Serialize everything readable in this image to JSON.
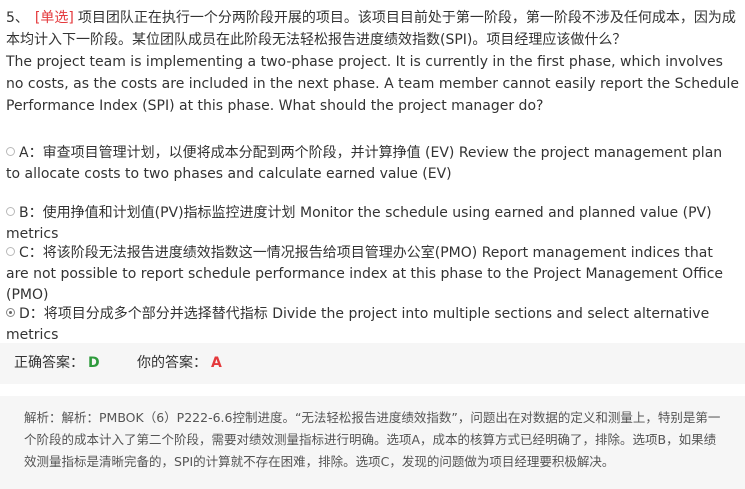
{
  "question": {
    "number": "5、",
    "type": "[单选]",
    "text_cn": "项目团队正在执行一个分两阶段开展的项目。该项目目前处于第一阶段，第一阶段不涉及任何成本，因为成本均计入下一阶段。某位团队成员在此阶段无法轻松报告进度绩效指数(SPI)。项目经理应该做什么？",
    "text_en": "The project team is implementing a two-phase project. It is currently in the first phase, which involves no costs, as the costs are included in the next phase. A team member cannot easily report the Schedule Performance Index (SPI) at this phase. What should the project manager do?"
  },
  "options": [
    {
      "label": "A：审查项目管理计划，以便将成本分配到两个阶段，并计算挣值 (EV) Review the project management plan to allocate costs to two phases and calculate earned value (EV)",
      "selected": false
    },
    {
      "label": "B：使用挣值和计划值(PV)指标监控进度计划 Monitor the schedule using earned and planned value (PV) metrics",
      "selected": false
    },
    {
      "label": "C：将该阶段无法报告进度绩效指数这一情况报告给项目管理办公室(PMO) Report management indices that are not possible to report schedule performance index at this phase to the Project Management Office (PMO)",
      "selected": false
    },
    {
      "label": "D：将项目分成多个部分并选择替代指标 Divide the project into multiple sections and select alternative metrics",
      "selected": true
    }
  ],
  "answer": {
    "correct_label": "正确答案：",
    "correct_value": "D",
    "your_label": "你的答案：",
    "your_value": "A"
  },
  "explanation": "解析：解析：PMBOK（6）P222-6.6控制进度。“无法轻松报告进度绩效指数”，问题出在对数据的定义和测量上，特别是第一个阶段的成本计入了第二个阶段，需要对绩效测量指标进行明确。选项A，成本的核算方式已经明确了，排除。选项B，如果绩效测量指标是清晰完备的，SPI的计算就不存在困难，排除。选项C，发现的问题做为项目经理要积极解决。",
  "colors": {
    "type_tag": "#e4393c",
    "correct": "#2e9b3c",
    "wrong": "#e4393c",
    "panel_bg": "#f6f6f6"
  }
}
